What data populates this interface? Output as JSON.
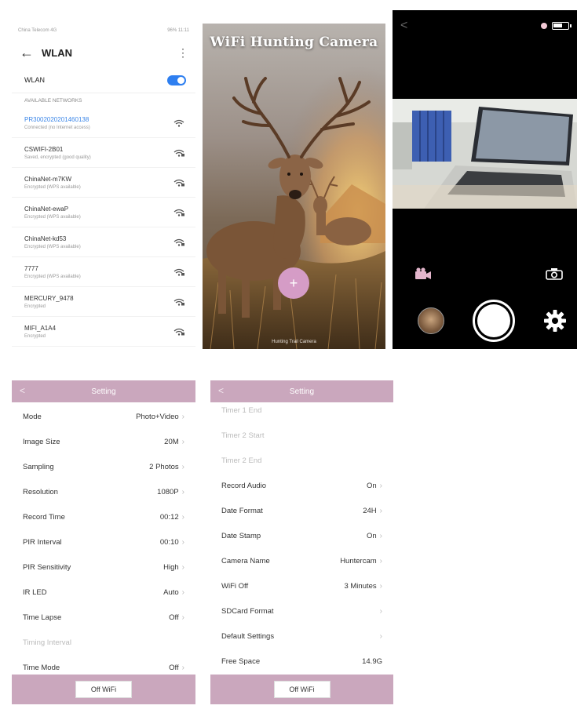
{
  "wlan": {
    "statusbar_left": "China Telecom 4G",
    "statusbar_right": "96% 11:11",
    "title": "WLAN",
    "toggle_label": "WLAN",
    "section_label": "AVAILABLE NETWORKS",
    "networks": [
      {
        "ssid": "PR3002020201460138",
        "desc": "Connected (no Internet access)"
      },
      {
        "ssid": "CSWIFI-2B01",
        "desc": "Saved, encrypted (good quality)"
      },
      {
        "ssid": "ChinaNet-m7KW",
        "desc": "Encrypted (WPS available)"
      },
      {
        "ssid": "ChinaNet-ewaP",
        "desc": "Encrypted (WPS available)"
      },
      {
        "ssid": "ChinaNet-kd53",
        "desc": "Encrypted (WPS available)"
      },
      {
        "ssid": "7777",
        "desc": "Encrypted (WPS available)"
      },
      {
        "ssid": "MERCURY_9478",
        "desc": "Encrypted"
      },
      {
        "ssid": "MIFI_A1A4",
        "desc": "Encrypted"
      }
    ]
  },
  "splash": {
    "title": "WiFi Hunting Camera",
    "plus": "+",
    "footer": "Hunting Trail Camera"
  },
  "camera": {
    "back": "<"
  },
  "settings1": {
    "title": "Setting",
    "back": "<",
    "rows": [
      {
        "label": "Mode",
        "value": "Photo+Video",
        "dim": false
      },
      {
        "label": "Image Size",
        "value": "20M",
        "dim": false
      },
      {
        "label": "Sampling",
        "value": "2 Photos",
        "dim": false
      },
      {
        "label": "Resolution",
        "value": "1080P",
        "dim": false
      },
      {
        "label": "Record Time",
        "value": "00:12",
        "dim": false
      },
      {
        "label": "PIR Interval",
        "value": "00:10",
        "dim": false
      },
      {
        "label": "PIR Sensitivity",
        "value": "High",
        "dim": false
      },
      {
        "label": "IR LED",
        "value": "Auto",
        "dim": false
      },
      {
        "label": "Time Lapse",
        "value": "Off",
        "dim": false
      },
      {
        "label": "Timing Interval",
        "value": "",
        "dim": true
      },
      {
        "label": "Time Mode",
        "value": "Off",
        "dim": false
      }
    ],
    "button": "Off WiFi"
  },
  "settings2": {
    "title": "Setting",
    "back": "<",
    "rows": [
      {
        "label": "Timer 1 End",
        "value": "",
        "dim": true
      },
      {
        "label": "Timer 2 Start",
        "value": "",
        "dim": true
      },
      {
        "label": "Timer 2 End",
        "value": "",
        "dim": true
      },
      {
        "label": "Record Audio",
        "value": "On",
        "dim": false
      },
      {
        "label": "Date Format",
        "value": "24H",
        "dim": false
      },
      {
        "label": "Date Stamp",
        "value": "On",
        "dim": false
      },
      {
        "label": "Camera Name",
        "value": "Huntercam",
        "dim": false
      },
      {
        "label": "WiFi Off",
        "value": "3 Minutes",
        "dim": false
      },
      {
        "label": "SDCard Format",
        "value": "",
        "dim": false
      },
      {
        "label": "Default Settings",
        "value": "",
        "dim": false
      },
      {
        "label": "Free Space",
        "value": "14.9G",
        "dim": false,
        "noChevron": true
      }
    ],
    "button": "Off WiFi"
  },
  "colors": {
    "accent_pink": "#caa7bd",
    "plus_pink": "#d59cc6",
    "link_blue": "#3b86e8",
    "switch_blue": "#2e7ff0"
  }
}
